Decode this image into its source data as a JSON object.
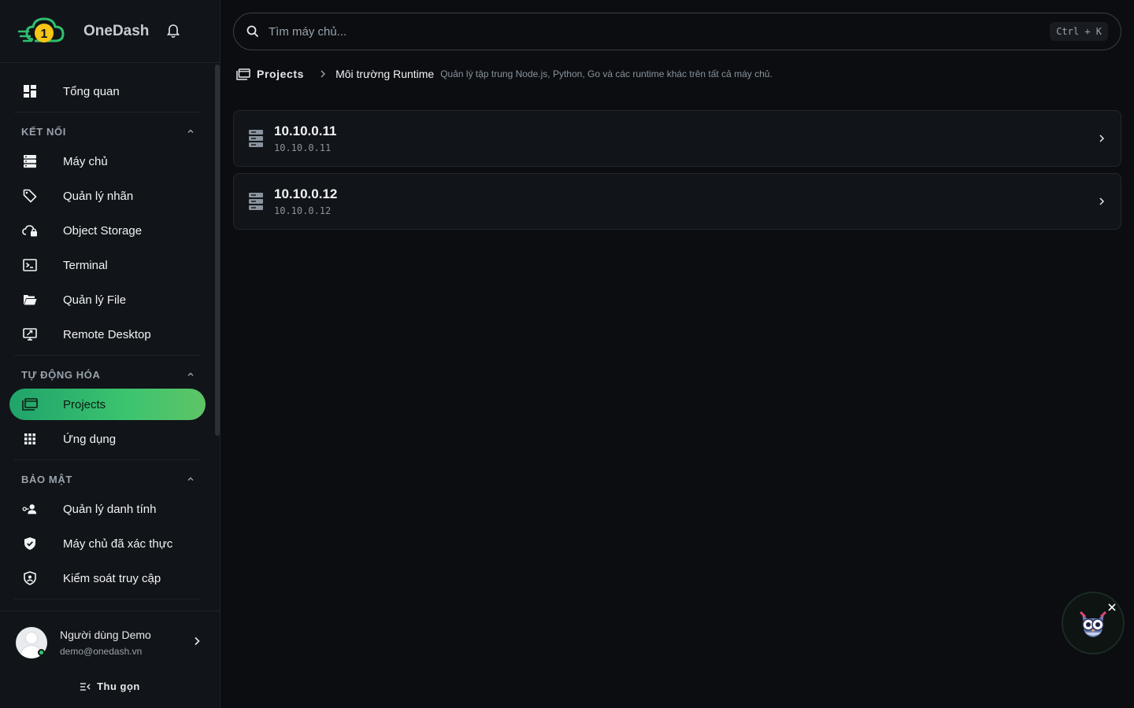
{
  "brand": {
    "name": "OneDash",
    "logo_glyph": "1"
  },
  "sidebar": {
    "overview": {
      "label": "Tổng quan",
      "icon": "dashboard-icon"
    },
    "sections": [
      {
        "title": "KẾT NỐI",
        "items": [
          {
            "label": "Máy chủ",
            "icon": "server-icon"
          },
          {
            "label": "Quản lý nhãn",
            "icon": "tag-icon"
          },
          {
            "label": "Object Storage",
            "icon": "cloud-lock-icon"
          },
          {
            "label": "Terminal",
            "icon": "terminal-icon"
          },
          {
            "label": "Quản lý File",
            "icon": "folder-open-icon"
          },
          {
            "label": "Remote Desktop",
            "icon": "remote-desktop-icon"
          }
        ]
      },
      {
        "title": "TỰ ĐỘNG HÓA",
        "items": [
          {
            "label": "Projects",
            "icon": "projects-icon",
            "active": true
          },
          {
            "label": "Ứng dụng",
            "icon": "apps-grid-icon"
          }
        ]
      },
      {
        "title": "BẢO MẬT",
        "items": [
          {
            "label": "Quản lý danh tính",
            "icon": "identity-icon"
          },
          {
            "label": "Máy chủ đã xác thực",
            "icon": "shield-check-icon"
          },
          {
            "label": "Kiểm soát truy cập",
            "icon": "access-control-icon"
          }
        ]
      }
    ]
  },
  "user": {
    "name": "Người dùng Demo",
    "email": "demo@onedash.vn",
    "status": "online"
  },
  "collapse_label": "Thu gọn",
  "search": {
    "placeholder": "Tìm máy chủ...",
    "shortcut": "Ctrl + K"
  },
  "breadcrumb": {
    "root": "Projects",
    "current": "Môi trường Runtime",
    "description": "Quản lý tập trung Node.js, Python, Go và các runtime khác trên tất cả máy chủ."
  },
  "servers": [
    {
      "title": "10.10.0.11",
      "subtitle": "10.10.0.11"
    },
    {
      "title": "10.10.0.12",
      "subtitle": "10.10.0.12"
    }
  ],
  "colors": {
    "accent": "#3cc46f",
    "background": "#0b0d10",
    "sidebar": "#111418"
  }
}
